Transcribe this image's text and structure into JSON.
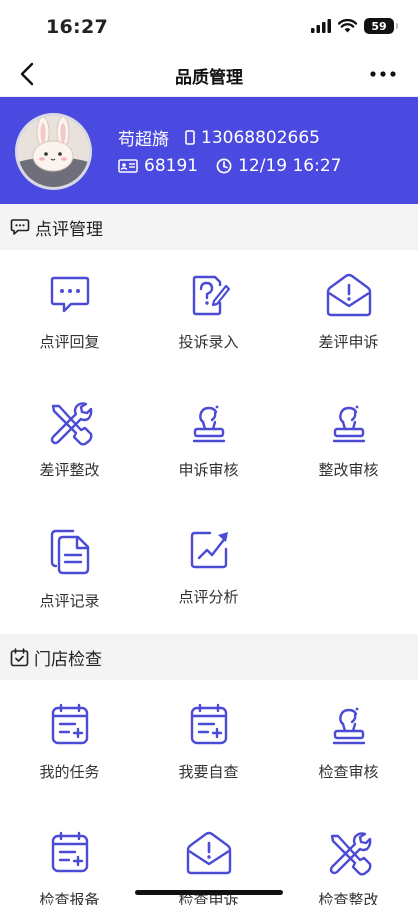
{
  "status_bar": {
    "time": "16:27",
    "battery": "59"
  },
  "nav": {
    "title": "品质管理"
  },
  "profile": {
    "name": "苟超旖",
    "phone": "13068802665",
    "employee_id": "68191",
    "datetime": "12/19 16:27"
  },
  "sections": [
    {
      "title": "点评管理",
      "items": [
        {
          "label": "点评回复",
          "icon": "chat-dots-icon"
        },
        {
          "label": "投诉录入",
          "icon": "question-doc-icon"
        },
        {
          "label": "差评申诉",
          "icon": "alert-envelope-icon"
        },
        {
          "label": "差评整改",
          "icon": "tools-icon"
        },
        {
          "label": "申诉审核",
          "icon": "stamp-icon"
        },
        {
          "label": "整改审核",
          "icon": "stamp-icon"
        },
        {
          "label": "点评记录",
          "icon": "documents-icon"
        },
        {
          "label": "点评分析",
          "icon": "chart-trend-icon"
        }
      ]
    },
    {
      "title": "门店检查",
      "items": [
        {
          "label": "我的任务",
          "icon": "task-list-icon"
        },
        {
          "label": "我要自查",
          "icon": "task-list-icon"
        },
        {
          "label": "检查审核",
          "icon": "stamp-icon"
        },
        {
          "label": "检查报备",
          "icon": "task-list-icon"
        },
        {
          "label": "检查申诉",
          "icon": "alert-envelope-icon"
        },
        {
          "label": "检查整改",
          "icon": "tools-icon"
        }
      ]
    }
  ],
  "colors": {
    "accent": "#4a4ae0",
    "icon": "#4b4bd6"
  }
}
